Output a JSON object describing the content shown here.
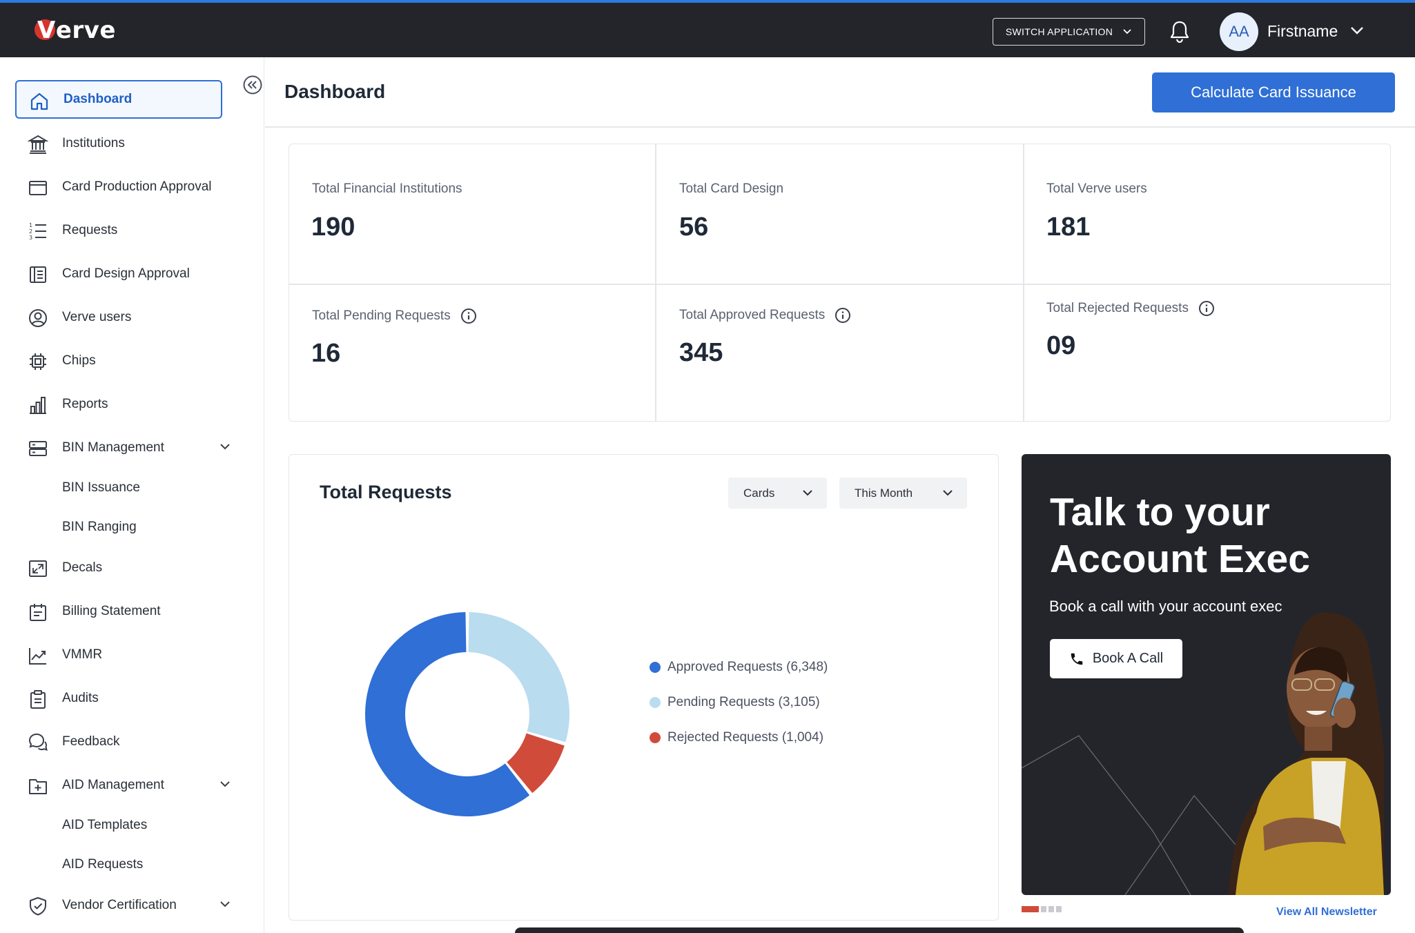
{
  "app": {
    "logo_text": "Verve",
    "switch_application": "SWITCH APPLICATION",
    "user": {
      "initials": "AA",
      "name": "Firstname"
    }
  },
  "sidebar": {
    "items": [
      {
        "label": "Dashboard",
        "icon": "home-icon",
        "active": true
      },
      {
        "label": "Institutions",
        "icon": "bank-icon"
      },
      {
        "label": "Card Production Approval",
        "icon": "card-icon"
      },
      {
        "label": "Requests",
        "icon": "list-icon"
      },
      {
        "label": "Card Design Approval",
        "icon": "document-icon"
      },
      {
        "label": "Verve users",
        "icon": "user-circle-icon"
      },
      {
        "label": "Chips",
        "icon": "chip-icon"
      },
      {
        "label": "Reports",
        "icon": "bar-chart-icon"
      },
      {
        "label": "BIN Management",
        "icon": "server-icon",
        "expandable": true
      },
      {
        "label": "Decals",
        "icon": "expand-icon"
      },
      {
        "label": "Billing Statement",
        "icon": "calendar-icon"
      },
      {
        "label": "VMMR",
        "icon": "line-chart-icon"
      },
      {
        "label": "Audits",
        "icon": "clipboard-icon"
      },
      {
        "label": "Feedback",
        "icon": "chat-icon"
      },
      {
        "label": "AID Management",
        "icon": "folder-plus-icon",
        "expandable": true
      },
      {
        "label": "Vendor Certification",
        "icon": "shield-check-icon",
        "expandable": true
      }
    ],
    "bin_sub": [
      "BIN Issuance",
      "BIN Ranging"
    ],
    "aid_sub": [
      "AID Templates",
      "AID Requests"
    ]
  },
  "header": {
    "title": "Dashboard",
    "calculate_button": "Calculate Card Issuance"
  },
  "stats": [
    {
      "label": "Total Financial Institutions",
      "value": "190",
      "info": false
    },
    {
      "label": "Total Card Design",
      "value": "56",
      "info": false
    },
    {
      "label": "Total Verve users",
      "value": "181",
      "info": false
    },
    {
      "label": "Total Pending Requests",
      "value": "16",
      "info": true
    },
    {
      "label": "Total Approved Requests",
      "value": "345",
      "info": true
    },
    {
      "label": "Total Rejected Requests",
      "value": "09",
      "info": true
    }
  ],
  "requests": {
    "title": "Total Requests",
    "filter_type": "Cards",
    "filter_period": "This Month"
  },
  "chart_data": {
    "type": "pie",
    "title": "Total Requests",
    "series": [
      {
        "name": "Approved Requests",
        "value": 6348,
        "color": "#2f6fd6",
        "legend": "Approved Requests (6,348)"
      },
      {
        "name": "Pending Requests",
        "value": 3105,
        "color": "#b9dcef",
        "legend": "Pending Requests (3,105)"
      },
      {
        "name": "Rejected Requests",
        "value": 1004,
        "color": "#d14b3a",
        "legend": "Rejected Requests (1,004)"
      }
    ]
  },
  "promo": {
    "title": "Talk to your Account Exec",
    "subtitle": "Book a call with your account exec",
    "button": "Book A Call",
    "newsletter_link": "View All Newsletter"
  }
}
